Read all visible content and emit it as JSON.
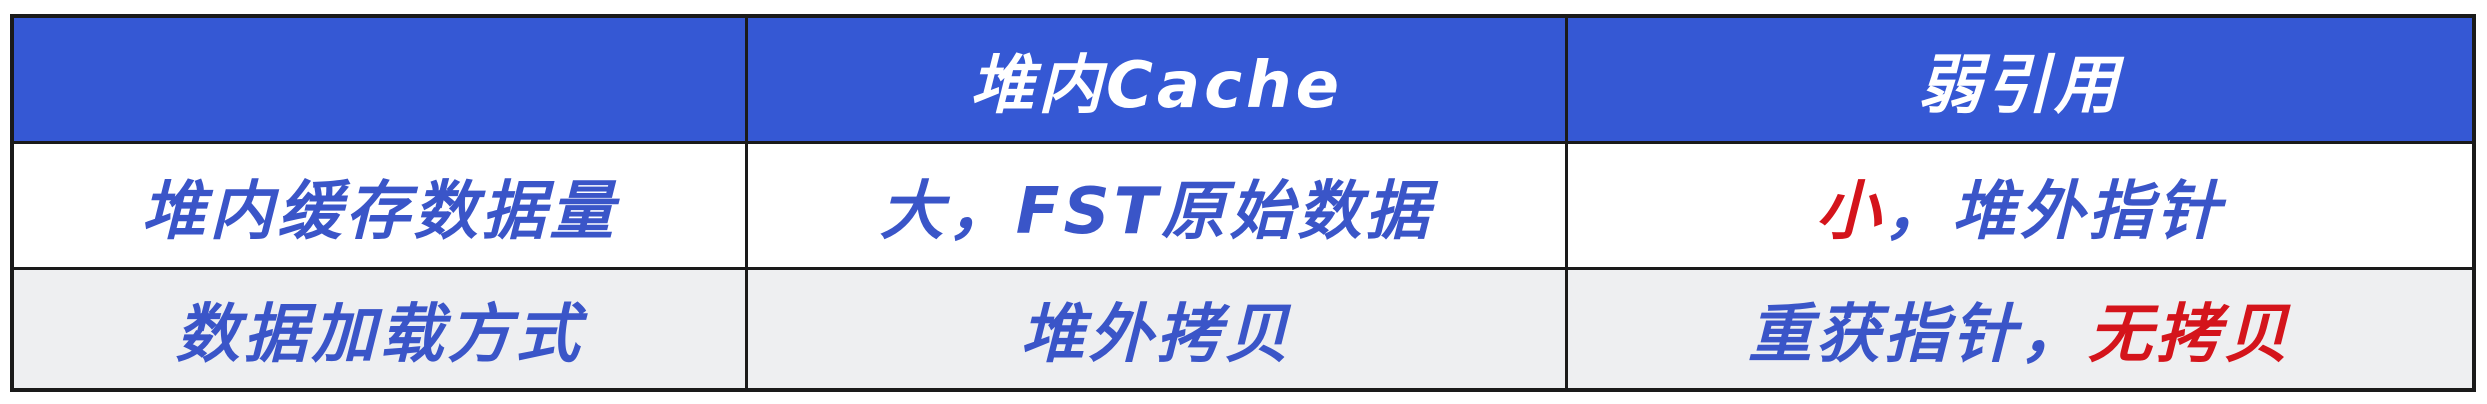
{
  "header": {
    "col0": "",
    "col1": "堆内Cache",
    "col2": "弱引用"
  },
  "rows": [
    {
      "label": "堆内缓存数据量",
      "col1": "大，FST原始数据",
      "col2_highlight": "小",
      "col2_rest": "，堆外指针"
    },
    {
      "label": "数据加载方式",
      "col1": "堆外拷贝",
      "col2_lead": "重获指针，",
      "col2_highlight": "无拷贝"
    }
  ],
  "colors": {
    "header_bg": "#3558d4",
    "text_blue": "#3a55c8",
    "highlight_red": "#d4141b",
    "alt_row_bg": "#eeeff1"
  }
}
